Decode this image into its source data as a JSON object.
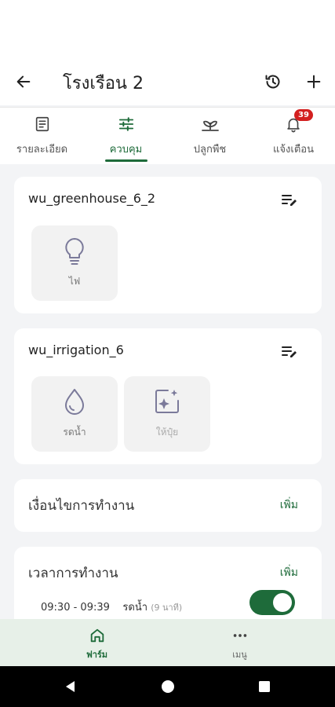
{
  "header": {
    "title": "โรงเรือน 2"
  },
  "tabs": [
    {
      "label": "รายละเอียด",
      "icon": "document-icon",
      "active": false
    },
    {
      "label": "ควบคุม",
      "icon": "sliders-icon",
      "active": true
    },
    {
      "label": "ปลูกพืช",
      "icon": "plant-icon",
      "active": false
    },
    {
      "label": "แจ้งเตือน",
      "icon": "bell-icon",
      "active": false,
      "badge": "39"
    }
  ],
  "devices": [
    {
      "name": "wu_greenhouse_6_2",
      "controls": [
        {
          "label": "ไฟ",
          "icon": "lightbulb-icon",
          "enabled": true
        }
      ]
    },
    {
      "name": "wu_irrigation_6",
      "controls": [
        {
          "label": "รดน้ำ",
          "icon": "water-drop-icon",
          "enabled": true
        },
        {
          "label": "ให้ปุ๋ย",
          "icon": "sparkle-box-icon",
          "enabled": false
        }
      ]
    }
  ],
  "conditions": {
    "title": "เงื่อนไขการทำงาน",
    "add_label": "เพิ่ม"
  },
  "schedule": {
    "title": "เวลาการทำงาน",
    "add_label": "เพิ่ม",
    "items": [
      {
        "time": "09:30 - 09:39",
        "action": "รดน้ำ",
        "duration": "(9 นาที)",
        "enabled": true
      }
    ]
  },
  "bottom_nav": [
    {
      "label": "ฟาร์ม",
      "icon": "home-icon",
      "active": true
    },
    {
      "label": "เมนู",
      "icon": "more-dots-icon",
      "active": false
    }
  ],
  "colors": {
    "accent": "#1e6b3a",
    "badge": "#d32020",
    "nav_bg": "#e7f0e8"
  }
}
